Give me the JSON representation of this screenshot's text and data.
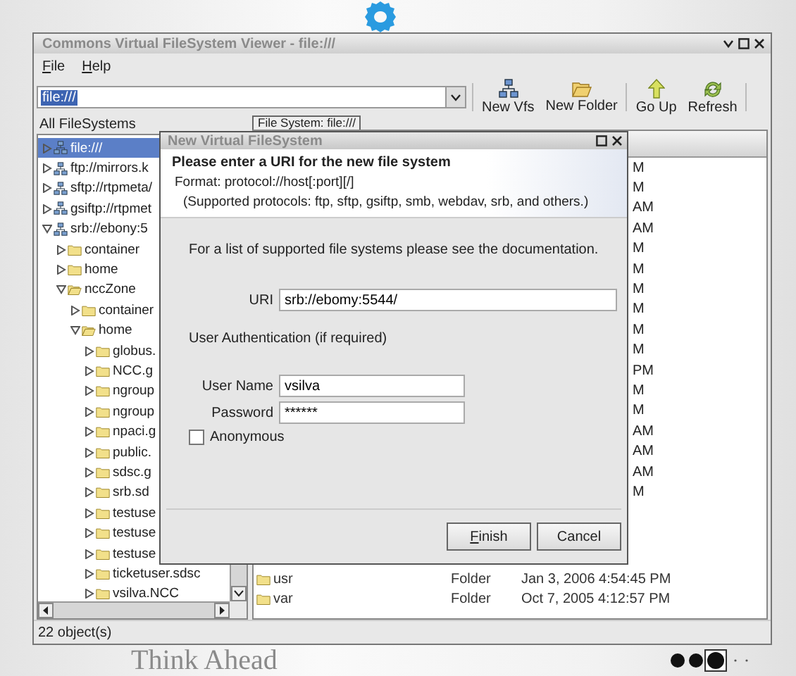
{
  "window": {
    "title": "Commons Virtual FileSystem Viewer - file:///"
  },
  "menu": [
    {
      "label": "File"
    },
    {
      "label": "Help"
    }
  ],
  "toolbar": {
    "location": "file:///",
    "buttons": [
      {
        "kind": "new-vfs",
        "label": "New Vfs"
      },
      {
        "kind": "new-folder",
        "label": "New Folder"
      },
      {
        "kind": "go-up",
        "label": "Go Up"
      },
      {
        "kind": "refresh",
        "label": "Refresh"
      }
    ]
  },
  "tree": {
    "title": "All FileSystems",
    "items": [
      {
        "kind": "filesystem",
        "label": "file:///",
        "selected": true,
        "expanded": false
      },
      {
        "kind": "filesystem",
        "label": "ftp://mirrors.k",
        "selected": false,
        "expanded": false
      },
      {
        "kind": "filesystem",
        "label": "sftp://rtpmeta/",
        "selected": false,
        "expanded": false
      },
      {
        "kind": "filesystem",
        "label": "gsiftp://rtpmet",
        "selected": false,
        "expanded": false
      },
      {
        "kind": "filesystem",
        "label": "srb://ebony:5",
        "selected": false,
        "expanded": true,
        "children": [
          {
            "kind": "folder",
            "label": "container",
            "selected": false,
            "expanded": false
          },
          {
            "kind": "folder",
            "label": "home",
            "selected": false,
            "expanded": false
          },
          {
            "kind": "folder",
            "label": "nccZone",
            "selected": false,
            "expanded": true,
            "children": [
              {
                "kind": "folder",
                "label": "container",
                "selected": false,
                "expanded": false
              },
              {
                "kind": "folder",
                "label": "home",
                "selected": false,
                "expanded": true,
                "children": [
                  {
                    "kind": "folder",
                    "label": "globus.",
                    "selected": false,
                    "expanded": false
                  },
                  {
                    "kind": "folder",
                    "label": "NCC.g",
                    "selected": false,
                    "expanded": false
                  },
                  {
                    "kind": "folder",
                    "label": "ngroup",
                    "selected": false,
                    "expanded": false
                  },
                  {
                    "kind": "folder",
                    "label": "ngroup",
                    "selected": false,
                    "expanded": false
                  },
                  {
                    "kind": "folder",
                    "label": "npaci.g",
                    "selected": false,
                    "expanded": false
                  },
                  {
                    "kind": "folder",
                    "label": "public.",
                    "selected": false,
                    "expanded": false
                  },
                  {
                    "kind": "folder",
                    "label": "sdsc.g",
                    "selected": false,
                    "expanded": false
                  },
                  {
                    "kind": "folder",
                    "label": "srb.sd",
                    "selected": false,
                    "expanded": false
                  },
                  {
                    "kind": "folder",
                    "label": "testuse",
                    "selected": false,
                    "expanded": false
                  },
                  {
                    "kind": "folder",
                    "label": "testuse",
                    "selected": false,
                    "expanded": false
                  },
                  {
                    "kind": "folder",
                    "label": "testuse",
                    "selected": false,
                    "expanded": false
                  },
                  {
                    "kind": "folder",
                    "label": "ticketuser.sdsc",
                    "selected": false,
                    "expanded": false
                  },
                  {
                    "kind": "folder",
                    "label": "vsilva.NCC",
                    "selected": false,
                    "expanded": false
                  }
                ]
              }
            ]
          }
        ]
      }
    ]
  },
  "tab": {
    "label": "File System: file:///"
  },
  "table": {
    "date_tails": [
      "M",
      "M",
      "AM",
      "AM",
      "M",
      "M",
      "M",
      "M",
      "M",
      "M",
      "PM",
      "M",
      "M",
      "AM",
      "AM",
      "AM",
      "M"
    ],
    "rows": [
      {
        "name": "usr",
        "type": "Folder",
        "modified": "Jan 3, 2006 4:54:45 PM"
      },
      {
        "name": "var",
        "type": "Folder",
        "modified": "Oct 7, 2005 4:12:57 PM"
      }
    ]
  },
  "status_bar": "22 object(s)",
  "dialog": {
    "title": "New Virtual FileSystem",
    "heading": "Please enter a URI for the new file system",
    "format": "Format: protocol://host[:port][/]",
    "protocols": "(Supported protocols: ftp, sftp, gsiftp, smb, webdav, srb, and others.)",
    "doc_note": "For a list of supported file systems please see the documentation.",
    "uri": {
      "label": "URI",
      "value": "srb://ebomy:5544/"
    },
    "auth_heading": "User Authentication (if required)",
    "username": {
      "label": "User Name",
      "value": "vsilva"
    },
    "password": {
      "label": "Password",
      "value": "******"
    },
    "anonymous": {
      "label": "Anonymous",
      "checked": false
    },
    "buttons": [
      {
        "label": "Finish",
        "mnemonic": true
      },
      {
        "label": "Cancel",
        "mnemonic": false
      }
    ]
  },
  "wallpaper": {
    "slogan": "Think Ahead"
  }
}
